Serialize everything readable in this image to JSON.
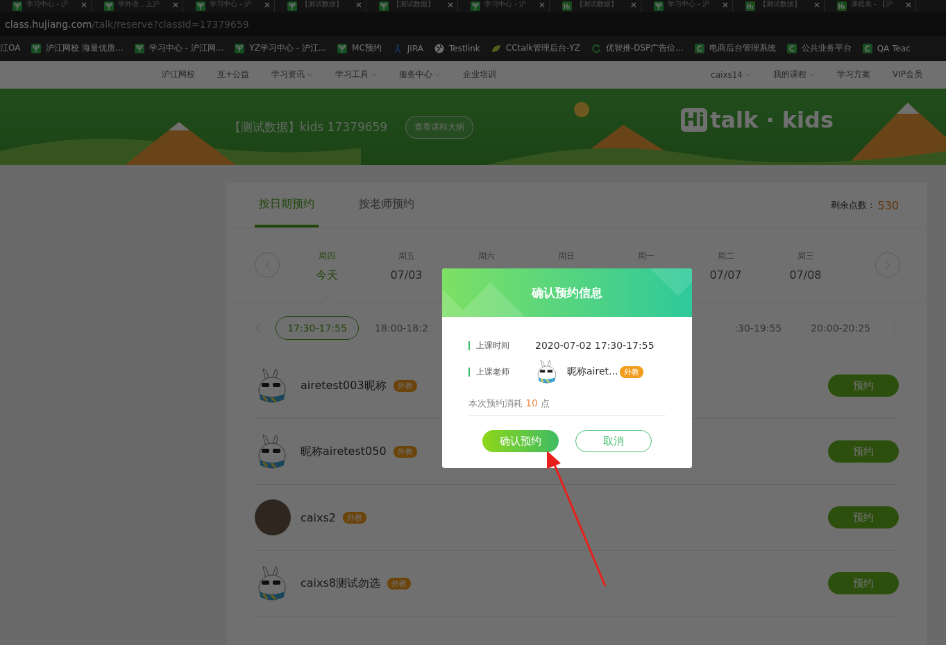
{
  "browser": {
    "tabs": [
      {
        "title": "学习中心 - 沪",
        "kind": "leaf"
      },
      {
        "title": "学外语，上沪",
        "kind": "leaf"
      },
      {
        "title": "学习中心 - 沪",
        "kind": "leaf"
      },
      {
        "title": "【测试数据】",
        "kind": "leaf"
      },
      {
        "title": "【测试数据】",
        "kind": "leaf"
      },
      {
        "title": "学习中心 - 沪",
        "kind": "leaf"
      },
      {
        "title": "【测试数据】",
        "kind": "hi"
      },
      {
        "title": "学习中心 - 沪",
        "kind": "leaf"
      },
      {
        "title": "【测试数据】",
        "kind": "hi"
      },
      {
        "title": "课程表 - 【沪",
        "kind": "hi"
      }
    ],
    "address": {
      "host": "class.hujiang.com",
      "path": "/talk/reserve?classId=17379659"
    },
    "bookmarks": [
      {
        "label": "江OA",
        "kind": "none"
      },
      {
        "label": "沪江网校 海量优质...",
        "kind": "leaf"
      },
      {
        "label": "学习中心 - 沪江网...",
        "kind": "leaf"
      },
      {
        "label": "YZ学习中心 - 沪江...",
        "kind": "leaf"
      },
      {
        "label": "MC预约",
        "kind": "leaf"
      },
      {
        "label": "JIRA",
        "kind": "jira"
      },
      {
        "label": "Testlink",
        "kind": "globe"
      },
      {
        "label": "CCtalk管理后台-YZ",
        "kind": "cctalk"
      },
      {
        "label": "优智推-DSP广告位...",
        "kind": "refresh"
      },
      {
        "label": "电商后台管理系统",
        "kind": "c"
      },
      {
        "label": "公共业务平台",
        "kind": "c"
      },
      {
        "label": "QA Teac",
        "kind": "c"
      }
    ]
  },
  "nav": {
    "left": [
      {
        "label": "沪江网校",
        "dropdown": false
      },
      {
        "label": "互+公益",
        "dropdown": false
      },
      {
        "label": "学习资讯",
        "dropdown": true
      },
      {
        "label": "学习工具",
        "dropdown": true
      },
      {
        "label": "服务中心",
        "dropdown": true
      },
      {
        "label": "企业培训",
        "dropdown": false
      }
    ],
    "right": [
      {
        "label": "caixs14",
        "dropdown": true
      },
      {
        "label": "我的课程",
        "dropdown": true
      },
      {
        "label": "学习方案",
        "dropdown": false
      },
      {
        "label": "VIP会员",
        "dropdown": false
      }
    ]
  },
  "banner": {
    "title": "【测试数据】kids 17379659",
    "syllabus_button": "查看课程大纲",
    "logo_mark": "Hi",
    "logo_text": "talk · kids"
  },
  "booking": {
    "tabs": [
      {
        "label": "按日期预约",
        "selected": true
      },
      {
        "label": "按老师预约",
        "selected": false
      }
    ],
    "points_label": "剩余点数：",
    "points": "530",
    "days": [
      {
        "weekday": "周四",
        "date": "今天",
        "selected": true
      },
      {
        "weekday": "周五",
        "date": "07/03",
        "selected": false
      },
      {
        "weekday": "周六",
        "selected": false
      },
      {
        "weekday": "周日",
        "selected": false
      },
      {
        "weekday": "周一",
        "selected": false
      },
      {
        "weekday": "周二",
        "date": "07/07",
        "selected": false
      },
      {
        "weekday": "周三",
        "date": "07/08",
        "selected": false
      }
    ],
    "slots": [
      {
        "time": "17:30-17:55",
        "selected": true
      },
      {
        "time": "18:00-18:2",
        "selected": false
      },
      {
        "time": ":30-19:55",
        "selected": false
      },
      {
        "time": "20:00-20:25",
        "selected": false
      }
    ],
    "teachers": [
      {
        "name": "airetest003昵称",
        "tag": "外教",
        "kind": "cartoon",
        "button": "预约"
      },
      {
        "name": "昵称airetest050",
        "tag": "外教",
        "kind": "cartoon",
        "button": "预约"
      },
      {
        "name": "caixs2",
        "tag": "外教",
        "kind": "photo",
        "button": "预约"
      },
      {
        "name": "caixs8测试勿选",
        "tag": "外教",
        "kind": "cartoon",
        "button": "预约"
      }
    ]
  },
  "dialog": {
    "title": "确认预约信息",
    "time_label": "上课时间",
    "time": "2020-07-02 17:30-17:55",
    "teacher_label": "上课老师",
    "teacher": "昵称airet...",
    "teacher_tag": "外教",
    "cost_before": "本次预约消耗",
    "cost": "10",
    "cost_after": "点",
    "confirm": "确认预约",
    "cancel": "取消"
  }
}
